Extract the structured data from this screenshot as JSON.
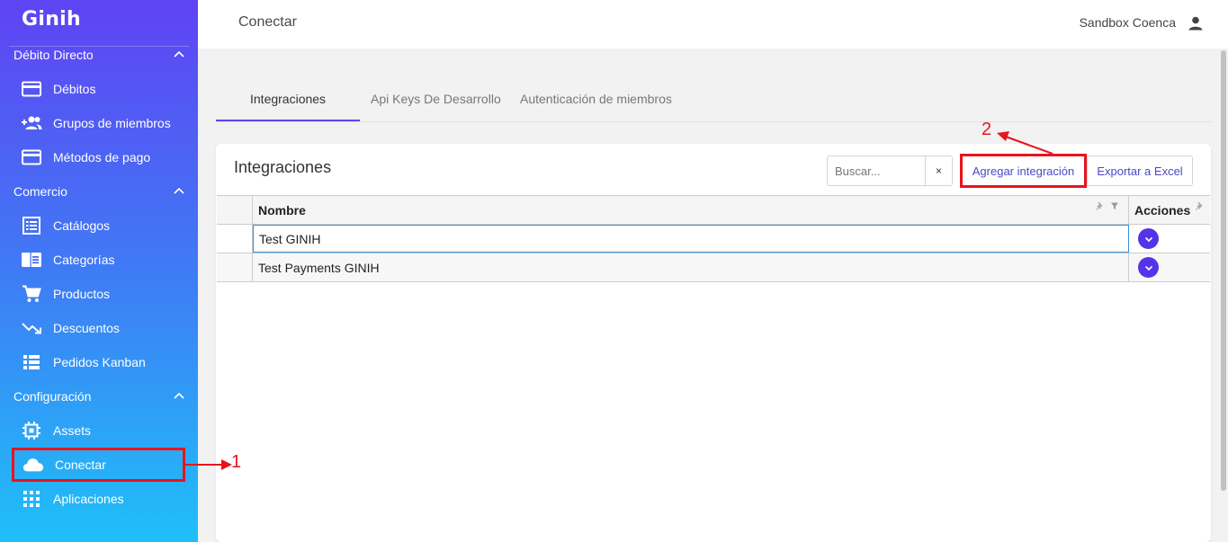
{
  "sidebar": {
    "logo": "Ginih",
    "sections": [
      {
        "label": "Débito Directo"
      },
      {
        "label": "Comercio"
      },
      {
        "label": "Configuración"
      }
    ],
    "items": [
      {
        "label": "Débitos"
      },
      {
        "label": "Grupos de miembros"
      },
      {
        "label": "Métodos de pago"
      },
      {
        "label": "Catálogos"
      },
      {
        "label": "Categorías"
      },
      {
        "label": "Productos"
      },
      {
        "label": "Descuentos"
      },
      {
        "label": "Pedidos Kanban"
      },
      {
        "label": "Assets"
      },
      {
        "label": "Conectar"
      },
      {
        "label": "Aplicaciones"
      }
    ]
  },
  "header": {
    "title": "Conectar",
    "user": "Sandbox Coenca"
  },
  "tabs": [
    {
      "label": "Integraciones"
    },
    {
      "label": "Api Keys De Desarrollo"
    },
    {
      "label": "Autenticación de miembros"
    }
  ],
  "card": {
    "title": "Integraciones",
    "search_placeholder": "Buscar...",
    "clear_label": "×",
    "add_label": "Agregar integración",
    "export_label": "Exportar a Excel"
  },
  "table": {
    "columns": [
      "Nombre",
      "Acciones"
    ],
    "rows": [
      {
        "name": "Test GINIH"
      },
      {
        "name": "Test Payments GINIH"
      }
    ]
  },
  "annotations": {
    "one": "1",
    "two": "2"
  },
  "colors": {
    "accent": "#5c44f0",
    "highlight": "#e8141c",
    "link": "#4e47c8"
  }
}
